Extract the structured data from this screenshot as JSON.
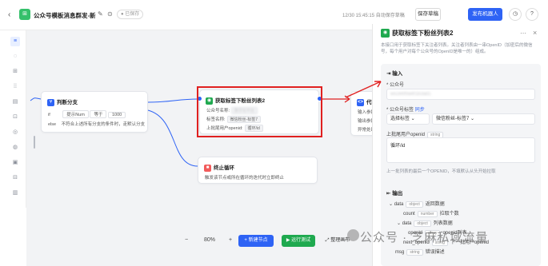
{
  "topbar": {
    "back": "‹",
    "app_title": "公众号模板消息群发-新",
    "dropdown": "⌄",
    "save_status": "已保存",
    "time_info": "12/30 15:45:15 自动保存草稿",
    "save_btn": "保存草稿",
    "publish_btn": "发布机器人",
    "clock": "◷",
    "help": "?"
  },
  "tools": [
    "≡",
    "◌",
    "⊞",
    "⁞⁞",
    "▤",
    "⊡",
    "◎",
    "◍",
    "▣",
    "⊟",
    "▥"
  ],
  "nodes": {
    "branch": {
      "title": "判断分支",
      "if_label": "if",
      "op1": "提示Num",
      "op2": "等于",
      "val": "1000",
      "else_label": "else",
      "else_text": "不符合上述所有分支的条件时，走默认分支"
    },
    "target": {
      "title": "获取标签下粉丝列表2",
      "r1_label": "公众号名称:",
      "r1_val": "数字化平台",
      "r2_label": "标签名称:",
      "r2_val": "微信粉丝-标签7",
      "r3_label": "上批尾用户openid:",
      "r3_val": "循环/id"
    },
    "loop": {
      "title": "终止循环",
      "desc": "触发该节点或所在循环的迭代时立即终止"
    },
    "code": {
      "title": "代码",
      "r1": "输入参数",
      "r2": "输出参数",
      "r3": "异常处理"
    }
  },
  "bottombar": {
    "minus": "−",
    "zoom": "80%",
    "plus": "+",
    "add_node": "+ 新建节点",
    "run_test": "▶ 运行测试",
    "tidy": "⤢ 整理画布"
  },
  "panel": {
    "title": "获取标签下粉丝列表2",
    "desc": "本接口用于获取标签下关注者列表。关注者列表由一串OpenID（加密后的微信号，每个用户对每个公众号的OpenID是唯一的）组成。",
    "input_title": "输入",
    "account_label": "* 公众号",
    "account_value": "wx2e6f9a4f1b3ad1",
    "tag_label": "* 公众号标签",
    "tag_sync": "同步",
    "tag_mode": "选择标签",
    "tag_value": "微信粉丝-标签7",
    "openid_label": "上批尾用户openid",
    "openid_type": "string",
    "openid_value": "循环/id",
    "hint": "上一批列表的最后一个OPENID，不填默认从头开始拉取",
    "output_title": "输出",
    "outputs": [
      {
        "name": "data",
        "type": "object",
        "desc": "返回数据"
      },
      {
        "name": "count",
        "type": "number",
        "desc": "拉取个数"
      },
      {
        "name": "data",
        "type": "object",
        "desc": "列表数据"
      },
      {
        "name": "openid",
        "type": "array",
        "desc": "openid列表"
      },
      {
        "name": "next_openid",
        "type": "string",
        "desc": "下一批用户openid"
      },
      {
        "name": "msg",
        "type": "string",
        "desc": "错误描述"
      }
    ]
  },
  "watermark": "公众号 · 芝麻私域流量",
  "colors": {
    "primary": "#2e63f5",
    "highlight": "#e02020",
    "success": "#1fa94f"
  }
}
